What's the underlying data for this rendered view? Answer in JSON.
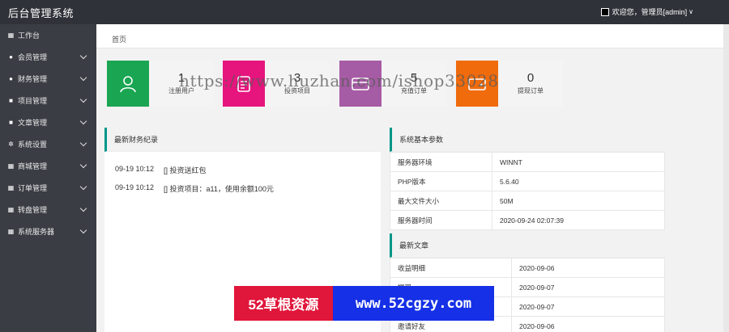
{
  "header": {
    "title": "后台管理系统",
    "user_text": "欢迎您，管理员[admin]",
    "caret": "∨"
  },
  "sidebar": {
    "items": [
      {
        "label": "工作台",
        "icon": "dashboard-icon",
        "glyph": "▦",
        "expandable": false
      },
      {
        "label": "会员管理",
        "icon": "member-icon",
        "glyph": "●",
        "expandable": true
      },
      {
        "label": "财务管理",
        "icon": "finance-icon",
        "glyph": "●",
        "expandable": true
      },
      {
        "label": "项目管理",
        "icon": "project-icon",
        "glyph": "■",
        "expandable": true
      },
      {
        "label": "文章管理",
        "icon": "article-icon",
        "glyph": "■",
        "expandable": true
      },
      {
        "label": "系统设置",
        "icon": "gear-icon",
        "glyph": "✲",
        "expandable": true
      },
      {
        "label": "商城管理",
        "icon": "shop-icon",
        "glyph": "▦",
        "expandable": true
      },
      {
        "label": "订单管理",
        "icon": "order-icon",
        "glyph": "▦",
        "expandable": true
      },
      {
        "label": "转盘管理",
        "icon": "wheel-icon",
        "glyph": "▦",
        "expandable": true
      },
      {
        "label": "系统服务器",
        "icon": "server-icon",
        "glyph": "▦",
        "expandable": true
      }
    ]
  },
  "breadcrumb": {
    "home": "首页"
  },
  "stats": [
    {
      "value": "1",
      "label": "注册用户",
      "color": "#1aa552",
      "icon": "user-icon"
    },
    {
      "value": "3",
      "label": "投资项目",
      "color": "#e6157d",
      "icon": "document-icon"
    },
    {
      "value": "5",
      "label": "充值订单",
      "color": "#a65ba5",
      "icon": "card-icon"
    },
    {
      "value": "0",
      "label": "提现订单",
      "color": "#f06b0c",
      "icon": "wallet-icon"
    }
  ],
  "finance_panel": {
    "title": "最新财务纪录",
    "rows": [
      {
        "time": "09-19 10:12",
        "text": "[] 投资送红包"
      },
      {
        "time": "09-19 10:12",
        "text": "[] 投资项目：a11，使用余额100元"
      }
    ]
  },
  "system_panel": {
    "title": "系统基本参数",
    "rows": [
      {
        "key": "服务器环境",
        "value": "WINNT"
      },
      {
        "key": "PHP版本",
        "value": "5.6.40"
      },
      {
        "key": "最大文件大小",
        "value": "50M"
      },
      {
        "key": "服务器时间",
        "value": "2020-09-24 02:07:39"
      }
    ]
  },
  "articles_panel": {
    "title": "最新文章",
    "rows": [
      {
        "key": "收益明细",
        "value": "2020-09-06"
      },
      {
        "key": "提现",
        "value": "2020-09-07"
      },
      {
        "key": "",
        "value": "2020-09-07"
      },
      {
        "key": "邀请好友",
        "value": "2020-09-06"
      }
    ]
  },
  "watermark": {
    "url_text": "https://www.huzhan.com/ishop33028",
    "banner_left": "52草根资源",
    "banner_right": "www.52cgzy.com"
  }
}
